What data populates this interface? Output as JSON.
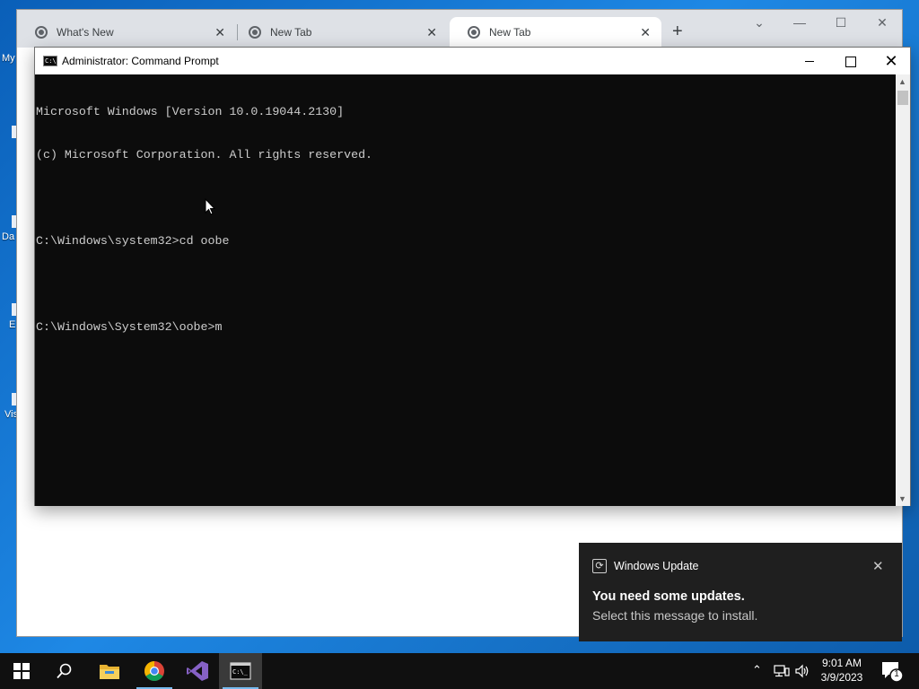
{
  "desktop": {
    "icon_labels": [
      "My",
      "Da",
      "E",
      "Vis"
    ]
  },
  "chrome": {
    "tabs": [
      {
        "label": "What's New",
        "active": false
      },
      {
        "label": "New Tab",
        "active": false
      },
      {
        "label": "New Tab",
        "active": true
      }
    ],
    "new_tab_symbol": "+",
    "close_symbol": "✕"
  },
  "cmd": {
    "title": "Administrator: Command Prompt",
    "lines": [
      "Microsoft Windows [Version 10.0.19044.2130]",
      "(c) Microsoft Corporation. All rights reserved.",
      "",
      "C:\\Windows\\system32>cd oobe",
      "",
      "C:\\Windows\\System32\\oobe>m"
    ]
  },
  "toast": {
    "app_name": "Windows Update",
    "title": "You need some updates.",
    "body": "Select this message to install."
  },
  "taskbar": {
    "time": "9:01 AM",
    "date": "3/9/2023",
    "notification_count": "1",
    "apps": [
      "start",
      "search",
      "file-explorer",
      "chrome",
      "visual-studio",
      "command-prompt"
    ]
  },
  "colors": {
    "console_bg": "#0c0c0c",
    "console_fg": "#cccccc",
    "taskbar_bg": "#101010",
    "toast_bg": "#1f1f1f",
    "desktop_blue": "#1b78d0"
  }
}
